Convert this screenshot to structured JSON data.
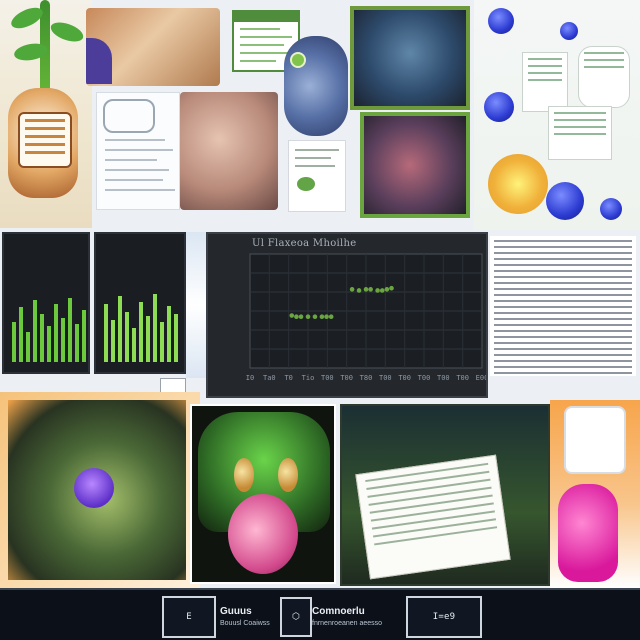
{
  "chart_card": {
    "title": "Ul   Flaxeoa   Mhoilhe"
  },
  "chart_data": {
    "type": "scatter",
    "title": "Ul   Flaxeoa   Mhoilhe",
    "xlabel": "",
    "ylabel": "",
    "x_ticks": [
      "I0",
      "Ta0",
      "T0",
      "Tio",
      "T00",
      "T00",
      "T80",
      "T00",
      "T00",
      "T00",
      "T00",
      "T00",
      "E00"
    ],
    "series": [
      {
        "points": [
          [
            0.18,
            0.46
          ],
          [
            0.2,
            0.45
          ],
          [
            0.22,
            0.45
          ],
          [
            0.25,
            0.45
          ],
          [
            0.28,
            0.45
          ],
          [
            0.31,
            0.45
          ],
          [
            0.33,
            0.45
          ],
          [
            0.35,
            0.45
          ],
          [
            0.44,
            0.69
          ],
          [
            0.47,
            0.68
          ],
          [
            0.5,
            0.69
          ],
          [
            0.52,
            0.69
          ],
          [
            0.55,
            0.68
          ],
          [
            0.57,
            0.68
          ],
          [
            0.59,
            0.69
          ],
          [
            0.61,
            0.7
          ]
        ],
        "color": "#6aa540"
      }
    ],
    "grid": true
  },
  "footer": {
    "left_label": "E",
    "middle_text": "Guuus",
    "middle_sub": "Bouusl   Coaiwss",
    "right_title": "Comnoerlu",
    "right_sub": "fnrnenroeanen aeesso",
    "end_label": "I=e9"
  },
  "colors": {
    "accent_green": "#6cc93d",
    "deep_blue": "#2c3bd1",
    "orange": "#f2a54a",
    "pink": "#d9189c"
  }
}
